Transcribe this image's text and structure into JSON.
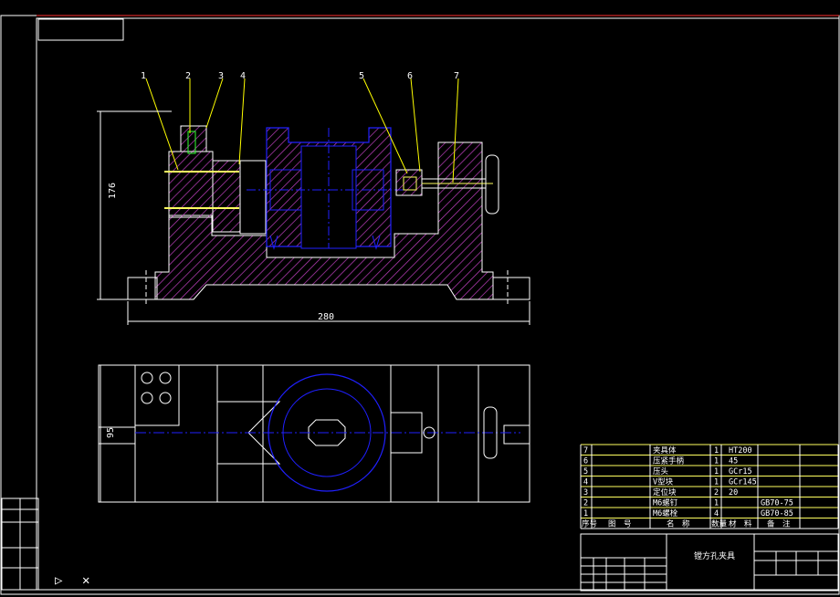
{
  "colors": {
    "background": "#000000",
    "outline": "#ffffff",
    "hatch": "#c040c0",
    "workpiece": "#2020ff",
    "leader": "#ffff00",
    "titleframe": "#ffffff",
    "border": "#ff3030",
    "fastener": "#ffff60"
  },
  "balloons": [
    "1",
    "2",
    "3",
    "4",
    "5",
    "6",
    "7"
  ],
  "dimensions": {
    "height": "176",
    "width": "280",
    "plan_depth": "95"
  },
  "parts_list": {
    "rows": [
      {
        "no": "7",
        "name": "夹具体",
        "qty": "1",
        "material": "HT200",
        "note": ""
      },
      {
        "no": "6",
        "name": "压紧手柄",
        "qty": "1",
        "material": "45",
        "note": ""
      },
      {
        "no": "5",
        "name": "压头",
        "qty": "1",
        "material": "GCr15",
        "note": ""
      },
      {
        "no": "4",
        "name": "V型块",
        "qty": "1",
        "material": "GCr145",
        "note": ""
      },
      {
        "no": "3",
        "name": "定位块",
        "qty": "2",
        "material": "20",
        "note": ""
      },
      {
        "no": "2",
        "name": "M6螺钉",
        "qty": "1",
        "material": "",
        "note": "GB70-75"
      },
      {
        "no": "1",
        "name": "M6螺栓",
        "qty": "4",
        "material": "",
        "note": "GB70-85"
      }
    ],
    "header": {
      "no": "序号",
      "code": "图　号",
      "name": "名　称",
      "qty": "数量",
      "material": "材　料",
      "note": "备　注"
    }
  },
  "title_block": {
    "title": "镗方孔夹具"
  }
}
